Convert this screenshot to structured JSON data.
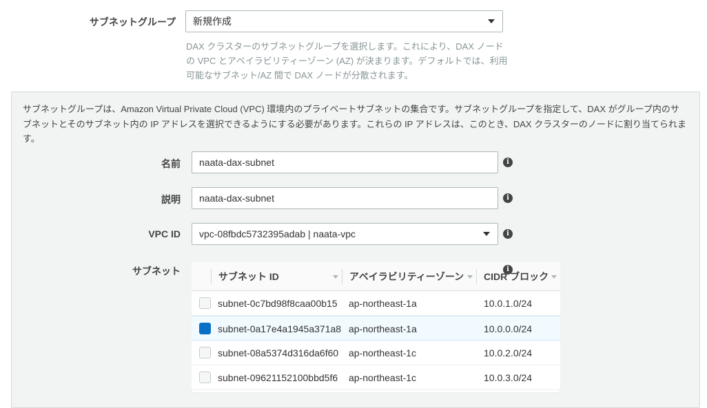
{
  "subnet_group": {
    "label": "サブネットグループ",
    "value": "新規作成",
    "help": "DAX クラスターのサブネットグループを選択します。これにより、DAX ノードの VPC とアベイラビリティーゾーン (AZ) が決まります。デフォルトでは、利用可能なサブネット/AZ 間で DAX ノードが分散されます。"
  },
  "panel": {
    "description": "サブネットグループは、Amazon Virtual Private Cloud (VPC) 環境内のプライベートサブネットの集合です。サブネットグループを指定して、DAX がグループ内のサブネットとそのサブネット内の IP アドレスを選択できるようにする必要があります。これらの IP アドレスは、このとき、DAX クラスターのノードに割り当てられます。",
    "name": {
      "label": "名前",
      "value": "naata-dax-subnet"
    },
    "description_field": {
      "label": "説明",
      "value": "naata-dax-subnet"
    },
    "vpc": {
      "label": "VPC ID",
      "value": "vpc-08fbdc5732395adab | naata-vpc"
    },
    "subnets": {
      "label": "サブネット",
      "columns": [
        "サブネット ID",
        "アベイラビリティーゾーン",
        "CIDR ブロック"
      ],
      "rows": [
        {
          "id": "subnet-0c7bd98f8caa00b15",
          "az": "ap-northeast-1a",
          "cidr": "10.0.1.0/24",
          "checked": false
        },
        {
          "id": "subnet-0a17e4a1945a371a8",
          "az": "ap-northeast-1a",
          "cidr": "10.0.0.0/24",
          "checked": true
        },
        {
          "id": "subnet-08a5374d316da6f60",
          "az": "ap-northeast-1c",
          "cidr": "10.0.2.0/24",
          "checked": false
        },
        {
          "id": "subnet-09621152100bbd5f6",
          "az": "ap-northeast-1c",
          "cidr": "10.0.3.0/24",
          "checked": false
        }
      ]
    }
  },
  "icons": {
    "info": "info-icon",
    "dropdown": "caret-down-icon"
  },
  "colors": {
    "checkbox_checked": "#0a6fc7",
    "selected_row": "#f1faff",
    "panel_bg": "#f2f3f3"
  }
}
